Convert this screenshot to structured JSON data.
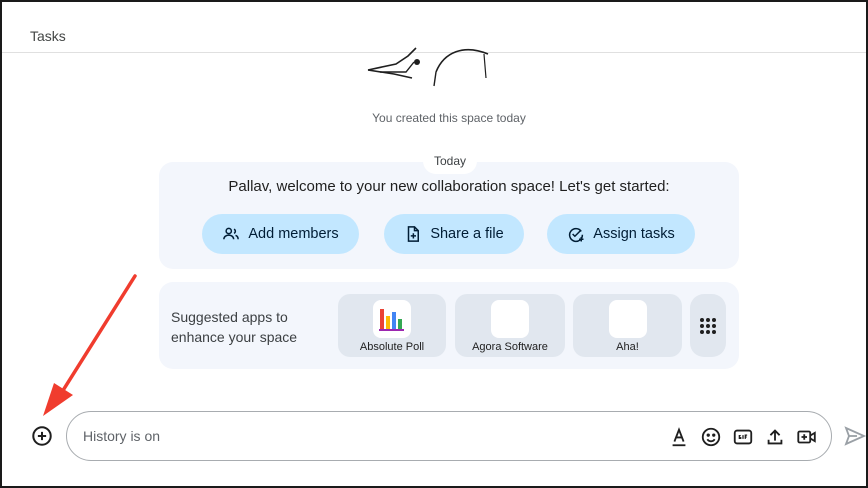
{
  "header": {
    "title": "Tasks"
  },
  "space": {
    "created_text": "You created this space today",
    "date_divider": "Today"
  },
  "welcome": {
    "message": "Pallav, welcome to your new collaboration space! Let's get started:",
    "actions": [
      {
        "label": "Add members",
        "icon": "add-members-icon"
      },
      {
        "label": "Share a file",
        "icon": "share-file-icon"
      },
      {
        "label": "Assign tasks",
        "icon": "assign-tasks-icon"
      }
    ]
  },
  "apps": {
    "label_line1": "Suggested apps to",
    "label_line2": "enhance your space",
    "items": [
      {
        "name": "Absolute Poll"
      },
      {
        "name": "Agora Software"
      },
      {
        "name": "Aha!"
      }
    ],
    "more_icon": "apps-grid-icon"
  },
  "compose": {
    "placeholder": "History is on",
    "tools": [
      "format-text-icon",
      "emoji-icon",
      "gif-icon",
      "upload-icon",
      "video-meeting-icon"
    ],
    "send_icon": "send-icon",
    "add_icon": "add-circle-icon"
  },
  "annotation": {
    "arrow_color": "#f03c2e"
  }
}
